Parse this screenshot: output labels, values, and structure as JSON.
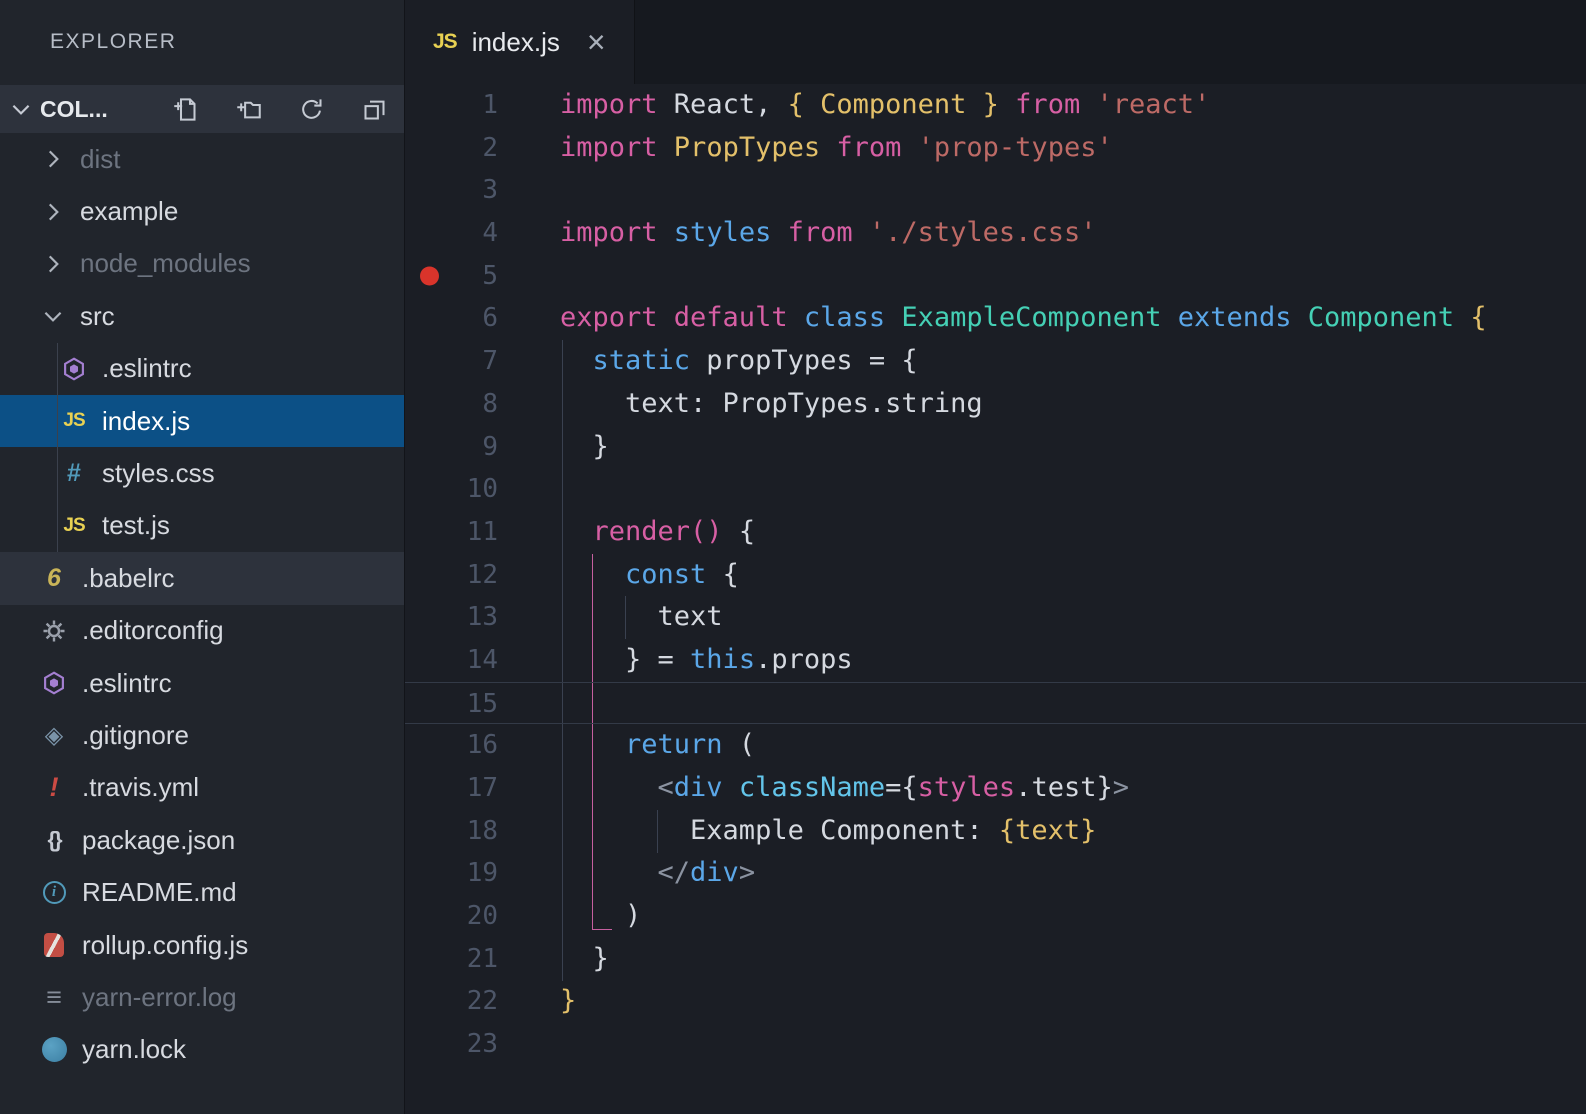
{
  "colors": {
    "kw": "#d75fa4",
    "st": "#5ba7e8",
    "ty": "#45d0b5",
    "yl": "#e3c06a",
    "str": "#bd6a66",
    "cy": "#63c5ea",
    "pu": "#8b93a1",
    "fg": "#d5d9e0",
    "lineNumber": "#4d5668",
    "breakpoint": "#d9342b",
    "selection": "#0c5086",
    "guidePink": "#c5609f",
    "sidebarBg": "#21252c",
    "editorBg": "#1b1e25"
  },
  "icon_glyphs": {
    "js": "JS",
    "css": "#",
    "babel": "6",
    "travis": "!",
    "json": "{}",
    "log": "≡",
    "gitignore": "◈",
    "readme": "i"
  },
  "sidebar": {
    "title": "EXPLORER",
    "section": {
      "label": "COL...",
      "actions": [
        "new-file",
        "new-folder",
        "refresh",
        "collapse-folders"
      ]
    },
    "tree": [
      {
        "label": "dist",
        "kind": "folder",
        "expanded": false,
        "dimmed": true
      },
      {
        "label": "example",
        "kind": "folder",
        "expanded": false
      },
      {
        "label": "node_modules",
        "kind": "folder",
        "expanded": false,
        "dimmed": true
      },
      {
        "label": "src",
        "kind": "folder",
        "expanded": true
      },
      {
        "label": ".eslintrc",
        "kind": "file",
        "icon": "eslint",
        "depth": 1
      },
      {
        "label": "index.js",
        "kind": "file",
        "icon": "js",
        "depth": 1,
        "selected": true
      },
      {
        "label": "styles.css",
        "kind": "file",
        "icon": "css",
        "depth": 1
      },
      {
        "label": "test.js",
        "kind": "file",
        "icon": "js",
        "depth": 1
      },
      {
        "label": ".babelrc",
        "kind": "file",
        "icon": "babel",
        "highlight": true
      },
      {
        "label": ".editorconfig",
        "kind": "file",
        "icon": "editorconfig"
      },
      {
        "label": ".eslintrc",
        "kind": "file",
        "icon": "eslint"
      },
      {
        "label": ".gitignore",
        "kind": "file",
        "icon": "gitignore"
      },
      {
        "label": ".travis.yml",
        "kind": "file",
        "icon": "travis"
      },
      {
        "label": "package.json",
        "kind": "file",
        "icon": "json"
      },
      {
        "label": "README.md",
        "kind": "file",
        "icon": "readme"
      },
      {
        "label": "rollup.config.js",
        "kind": "file",
        "icon": "rollup"
      },
      {
        "label": "yarn-error.log",
        "kind": "file",
        "icon": "log",
        "dimmed": true
      },
      {
        "label": "yarn.lock",
        "kind": "file",
        "icon": "yarn"
      }
    ]
  },
  "tab": {
    "label": "index.js",
    "close_glyph": "×"
  },
  "editor": {
    "breakpoint_line": 5,
    "current_line": 15,
    "line_count": 23,
    "lines": [
      [
        [
          "kw",
          "import"
        ],
        [
          "pl",
          " React, "
        ],
        [
          "yl",
          "{ Component }"
        ],
        [
          "kw",
          " from"
        ],
        [
          "str",
          " 'react'"
        ]
      ],
      [
        [
          "kw",
          "import"
        ],
        [
          "yl",
          " PropTypes"
        ],
        [
          "kw",
          " from"
        ],
        [
          "str",
          " 'prop-types'"
        ]
      ],
      [],
      [
        [
          "kw",
          "import"
        ],
        [
          "st",
          " styles"
        ],
        [
          "kw",
          " from"
        ],
        [
          "str",
          " './styles.css'"
        ]
      ],
      [],
      [
        [
          "kw",
          "export default"
        ],
        [
          "st",
          " class"
        ],
        [
          "ty",
          " ExampleComponent"
        ],
        [
          "st",
          " extends"
        ],
        [
          "ty",
          " Component"
        ],
        [
          "yl",
          " {"
        ]
      ],
      [
        [
          "st",
          "  static"
        ],
        [
          "pl",
          " propTypes = {"
        ]
      ],
      [
        [
          "pl",
          "    text: PropTypes.string"
        ]
      ],
      [
        [
          "pl",
          "  }"
        ]
      ],
      [],
      [
        [
          "kw",
          "  render()"
        ],
        [
          "pl",
          " {"
        ]
      ],
      [
        [
          "st",
          "    const"
        ],
        [
          "pl",
          " {"
        ]
      ],
      [
        [
          "pl",
          "      text"
        ]
      ],
      [
        [
          "pl",
          "    } = "
        ],
        [
          "st",
          "this"
        ],
        [
          "pl",
          ".props"
        ]
      ],
      [],
      [
        [
          "st",
          "    return"
        ],
        [
          "pl",
          " ("
        ]
      ],
      [
        [
          "pu",
          "      <"
        ],
        [
          "st",
          "div"
        ],
        [
          "cy",
          " className"
        ],
        [
          "pl",
          "={"
        ],
        [
          "kw",
          "styles"
        ],
        [
          "pl",
          ".test}"
        ],
        [
          "pu",
          ">"
        ]
      ],
      [
        [
          "pl",
          "        Example Component: "
        ],
        [
          "yl",
          "{text}"
        ]
      ],
      [
        [
          "pu",
          "      </"
        ],
        [
          "st",
          "div"
        ],
        [
          "pu",
          ">"
        ]
      ],
      [
        [
          "pl",
          "    )"
        ]
      ],
      [
        [
          "pl",
          "  }"
        ]
      ],
      [
        [
          "yl",
          "}"
        ]
      ],
      []
    ]
  }
}
